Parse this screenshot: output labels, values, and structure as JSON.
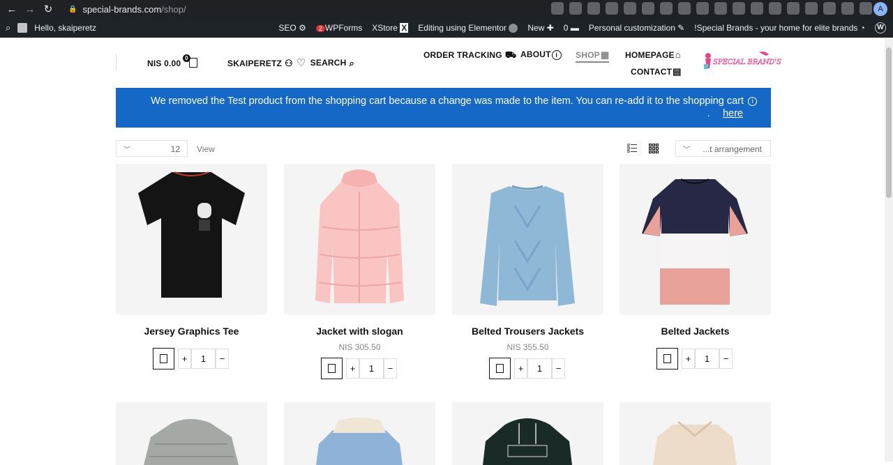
{
  "browser": {
    "url_host": "special-brands.com",
    "url_path": "/shop/",
    "avatar_letter": "A"
  },
  "wpbar": {
    "greeting": "Hello, skaiperetz",
    "seo": "SEO",
    "wpforms": "WPForms",
    "wpforms_badge": "2",
    "xstore": "XStore",
    "elementor": "Editing using Elementor",
    "new": "New",
    "comments": "0",
    "customize": "Personal customization",
    "site": "!Special Brands - your home for elite brands"
  },
  "header": {
    "cart_total": "NIS 0.00",
    "cart_count": "0",
    "account": "SKAIPERETZ",
    "search": "SEARCH",
    "order_tracking": "ORDER TRACKING",
    "about": "ABOUT",
    "shop": "SHOP",
    "homepage": "HOMEPAGE",
    "contact": "CONTACT",
    "logo_text": "SPECIAL BRAND'S"
  },
  "notice": {
    "message": "We removed the Test product from the shopping cart because a change was made to the item. You can re-add it to the shopping cart",
    "link_prefix": ". ",
    "link": "here"
  },
  "toolbar": {
    "per_page": "12",
    "view_label": "View",
    "sort_label": "...t arrangement"
  },
  "products": [
    {
      "name": "Jersey Graphics Tee",
      "price": "",
      "qty": "1"
    },
    {
      "name": "Jacket with slogan",
      "price": "NIS 305.50",
      "qty": "1"
    },
    {
      "name": "Belted Trousers Jackets",
      "price": "NIS 355.50",
      "qty": "1"
    },
    {
      "name": "Belted Jackets",
      "price": "",
      "qty": "1"
    }
  ],
  "qty_controls": {
    "plus": "+",
    "minus": "−"
  },
  "colors": {
    "notice_bg": "#1568c5",
    "wpbar_bg": "#1d2327",
    "chrome_bg": "#202124",
    "logo_pink": "#e6468e"
  }
}
